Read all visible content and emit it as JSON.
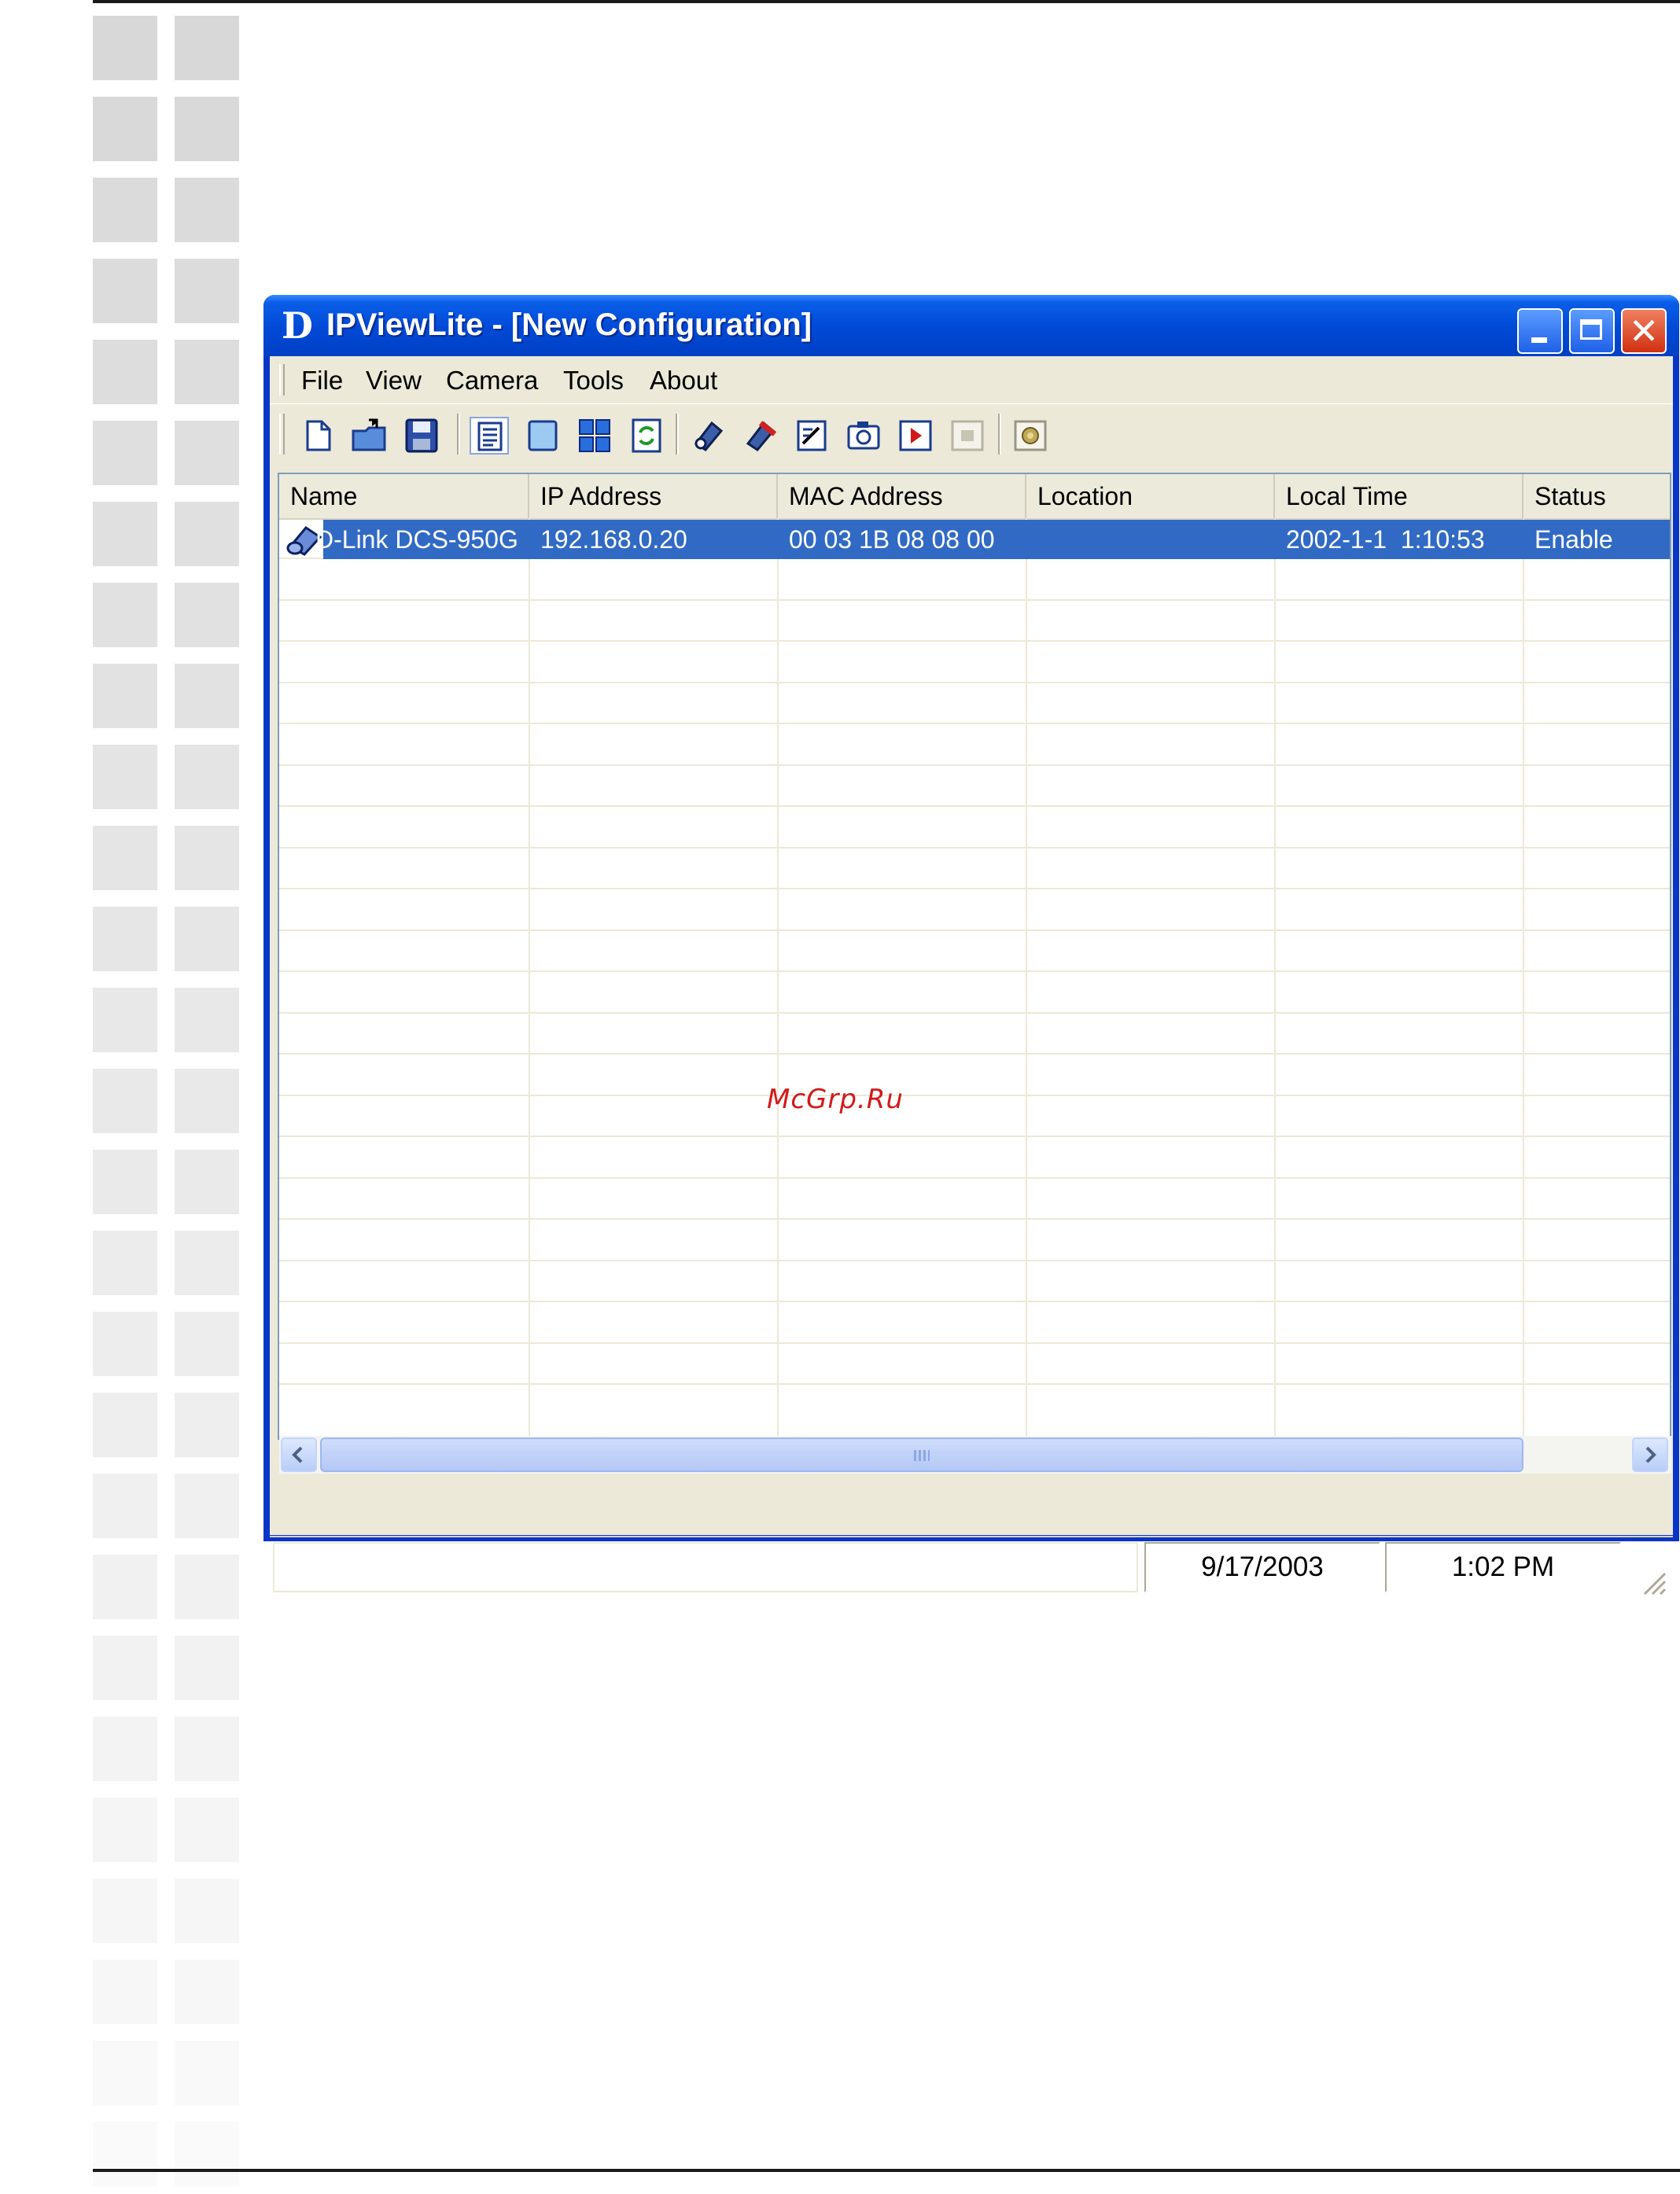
{
  "window": {
    "title": "IPViewLite - [New Configuration]",
    "logo_letter": "D"
  },
  "menu": {
    "items": [
      {
        "label": "File"
      },
      {
        "label": "View"
      },
      {
        "label": "Camera"
      },
      {
        "label": "Tools"
      },
      {
        "label": "About"
      }
    ]
  },
  "toolbar": {
    "icons": [
      "new-file-icon",
      "open-file-icon",
      "save-icon",
      "list-view-icon",
      "single-view-icon",
      "quad-view-icon",
      "refresh-icon",
      "add-camera-icon",
      "remove-camera-icon",
      "camera-settings-icon",
      "snapshot-icon",
      "record-icon",
      "stop-icon",
      "globe-icon"
    ]
  },
  "table": {
    "columns": [
      "Name",
      "IP Address",
      "MAC Address",
      "Location",
      "Local Time",
      "Status"
    ],
    "rows": [
      {
        "name": "D-Link DCS-950G",
        "ip": "192.168.0.20",
        "mac": "00 03 1B 08 08 00",
        "location": "",
        "local_time": "2002-1-1  1:10:53",
        "status": "Enable",
        "selected": true
      }
    ]
  },
  "statusbar": {
    "date": "9/17/2003",
    "time": "1:02 PM"
  },
  "watermark": "McGrp.Ru",
  "colors": {
    "title_bar": "#0049d6",
    "selection": "#316ac5",
    "window_face": "#ece9d8",
    "watermark": "#d21a1a"
  }
}
